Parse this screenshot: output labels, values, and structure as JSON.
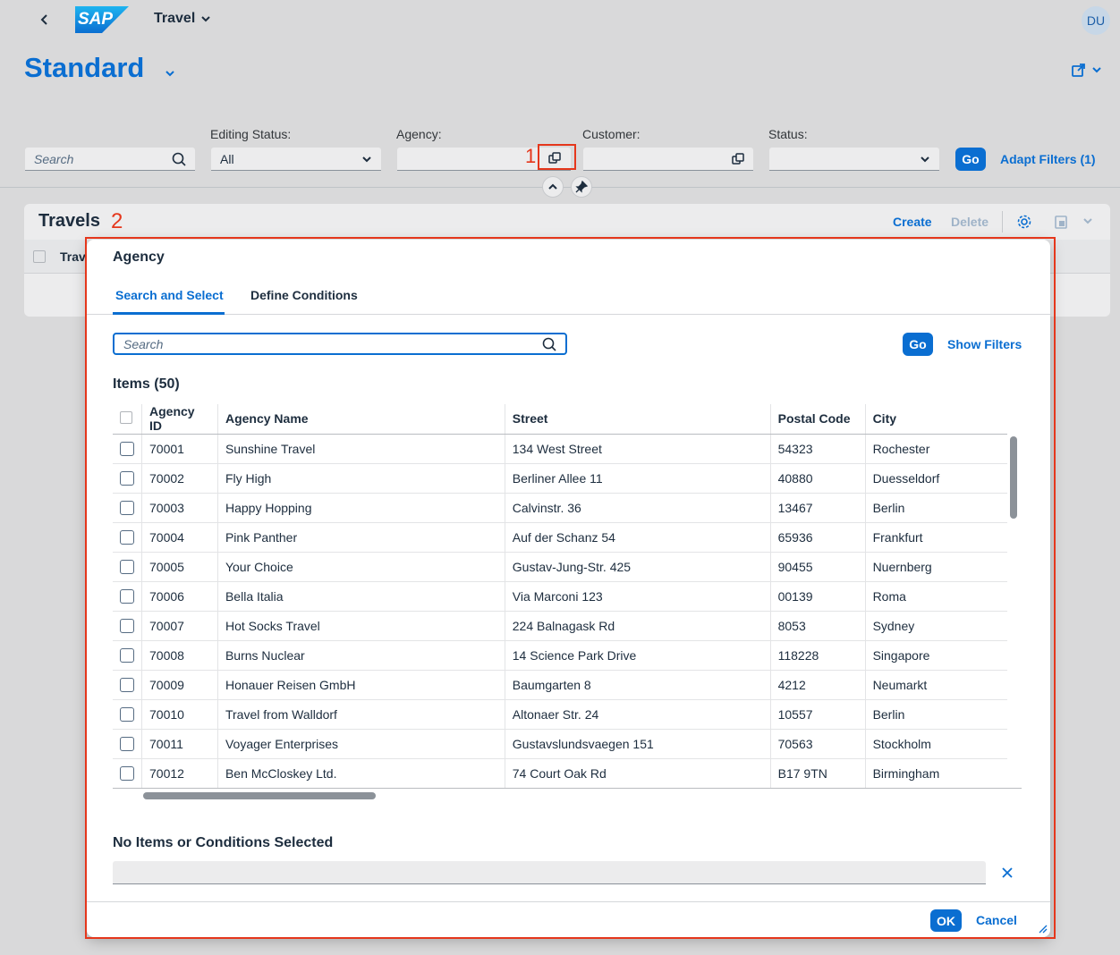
{
  "shell": {
    "app_title": "Travel",
    "avatar_initials": "DU",
    "logo_text": "SAP"
  },
  "variant": {
    "title": "Standard"
  },
  "filters": {
    "search_placeholder": "Search",
    "editing_status_label": "Editing Status:",
    "editing_status_value": "All",
    "agency_label": "Agency:",
    "customer_label": "Customer:",
    "status_label": "Status:",
    "go_label": "Go",
    "adapt_filters_label": "Adapt Filters (1)"
  },
  "travels": {
    "title": "Travels",
    "create_label": "Create",
    "delete_label": "Delete",
    "col_truncated": "Trav"
  },
  "annotations": {
    "marker1": "1",
    "marker2": "2"
  },
  "dialog": {
    "title": "Agency",
    "tabs": [
      "Search and Select",
      "Define Conditions"
    ],
    "search_placeholder": "Search",
    "go_label": "Go",
    "show_filters_label": "Show Filters",
    "items_title": "Items (50)",
    "columns": [
      "Agency ID",
      "Agency Name",
      "Street",
      "Postal Code",
      "City"
    ],
    "rows": [
      [
        "70001",
        "Sunshine Travel",
        "134 West Street",
        "54323",
        "Rochester"
      ],
      [
        "70002",
        "Fly High",
        "Berliner Allee 11",
        "40880",
        "Duesseldorf"
      ],
      [
        "70003",
        "Happy Hopping",
        "Calvinstr. 36",
        "13467",
        "Berlin"
      ],
      [
        "70004",
        "Pink Panther",
        "Auf der Schanz 54",
        "65936",
        "Frankfurt"
      ],
      [
        "70005",
        "Your Choice",
        "Gustav-Jung-Str. 425",
        "90455",
        "Nuernberg"
      ],
      [
        "70006",
        "Bella Italia",
        "Via Marconi 123",
        "00139",
        "Roma"
      ],
      [
        "70007",
        "Hot Socks Travel",
        "224 Balnagask Rd",
        "8053",
        "Sydney"
      ],
      [
        "70008",
        "Burns Nuclear",
        "14 Science Park Drive",
        "118228",
        "Singapore"
      ],
      [
        "70009",
        "Honauer Reisen GmbH",
        "Baumgarten 8",
        "4212",
        "Neumarkt"
      ],
      [
        "70010",
        "Travel from Walldorf",
        "Altonaer Str. 24",
        "10557",
        "Berlin"
      ],
      [
        "70011",
        "Voyager Enterprises",
        "Gustavslundsvaegen 151",
        "70563",
        "Stockholm"
      ],
      [
        "70012",
        "Ben McCloskey Ltd.",
        "74 Court Oak Rd",
        "B17 9TN",
        "Birmingham"
      ]
    ],
    "selection_title": "No Items or Conditions Selected",
    "ok_label": "OK",
    "cancel_label": "Cancel"
  },
  "colors": {
    "brand": "#0a6ed1",
    "annotation": "#e5371c"
  }
}
